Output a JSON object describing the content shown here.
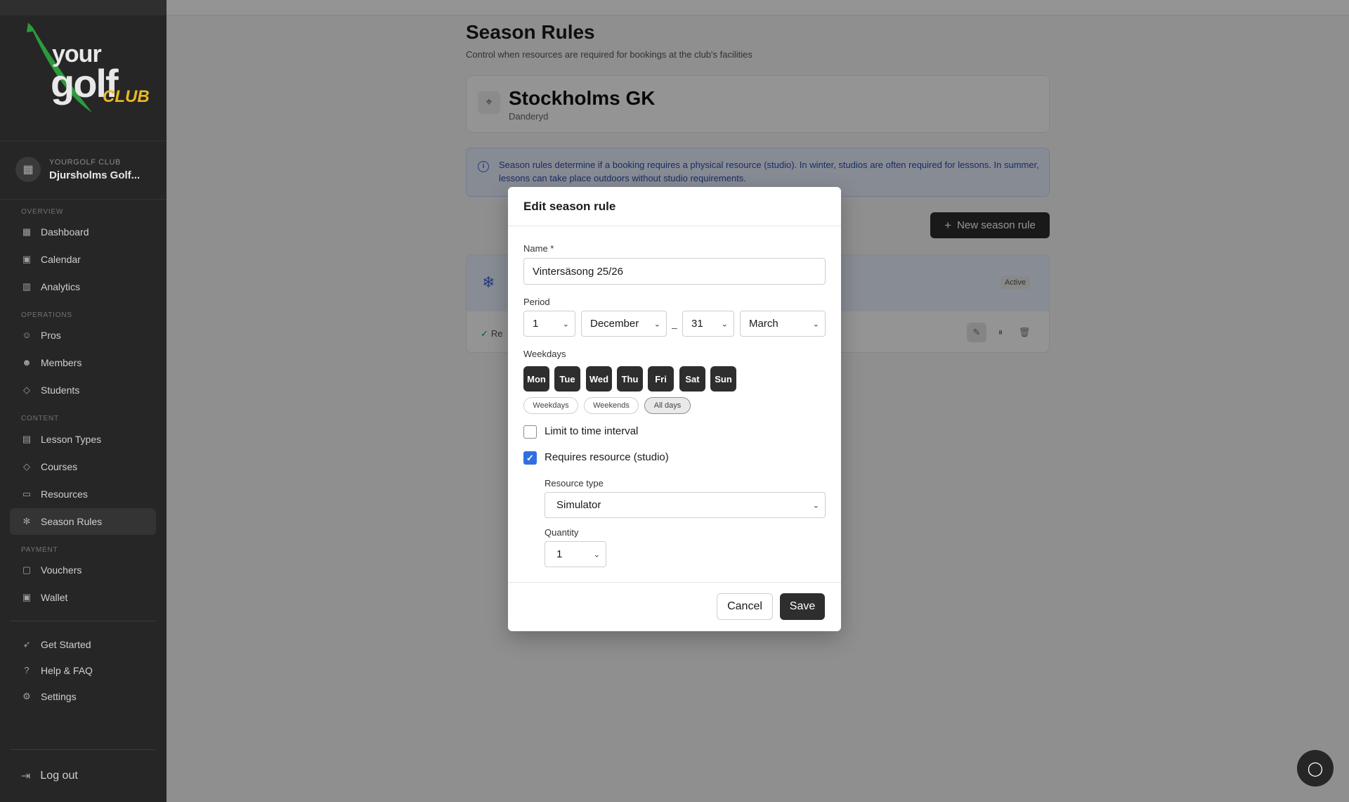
{
  "brand": {
    "logo_your": "your",
    "logo_golf": "golf",
    "logo_club": "CLUB"
  },
  "club_switcher": {
    "eyebrow": "YOURGOLF CLUB",
    "name": "Djursholms Golf..."
  },
  "sidebar": {
    "sections": {
      "overview": "OVERVIEW",
      "operations": "OPERATIONS",
      "content": "CONTENT",
      "payment": "PAYMENT"
    },
    "items": [
      {
        "label": "Dashboard",
        "icon": "grid-icon"
      },
      {
        "label": "Calendar",
        "icon": "calendar-icon"
      },
      {
        "label": "Analytics",
        "icon": "bar-chart-icon"
      },
      {
        "label": "Pros",
        "icon": "users-icon"
      },
      {
        "label": "Members",
        "icon": "user-check-icon"
      },
      {
        "label": "Students",
        "icon": "graduation-cap-icon"
      },
      {
        "label": "Lesson Types",
        "icon": "book-icon"
      },
      {
        "label": "Courses",
        "icon": "graduation-cap-icon"
      },
      {
        "label": "Resources",
        "icon": "monitor-icon"
      },
      {
        "label": "Season Rules",
        "icon": "snowflake-icon",
        "active": true
      },
      {
        "label": "Vouchers",
        "icon": "ticket-icon"
      },
      {
        "label": "Wallet",
        "icon": "wallet-icon"
      },
      {
        "label": "Get Started",
        "icon": "rocket-icon"
      },
      {
        "label": "Help & FAQ",
        "icon": "help-circle-icon"
      },
      {
        "label": "Settings",
        "icon": "gear-icon"
      }
    ],
    "logout": "Log out"
  },
  "main": {
    "title": "Season Rules",
    "subtitle": "Control when resources are required for bookings at the club's facilities",
    "club": {
      "name": "Stockholms GK",
      "location": "Danderyd"
    },
    "info": "Season rules determine if a booking requires a physical resource (studio). In winter, studios are often required for lessons. In summer, lessons can take place outdoors without studio requirements.",
    "new_button": "New season rule",
    "rule": {
      "badge": "Active",
      "row_text": "Re"
    }
  },
  "modal": {
    "title": "Edit season rule",
    "name_label": "Name *",
    "name_value": "Vintersäsong 25/26",
    "period_label": "Period",
    "period": {
      "from_day": "1",
      "from_month": "December",
      "separator": "–",
      "to_day": "31",
      "to_month": "March"
    },
    "weekdays_label": "Weekdays",
    "days": [
      "Mon",
      "Tue",
      "Wed",
      "Thu",
      "Fri",
      "Sat",
      "Sun"
    ],
    "presets": [
      "Weekdays",
      "Weekends",
      "All days"
    ],
    "limit_label": "Limit to time interval",
    "limit_checked": false,
    "requires_label": "Requires resource (studio)",
    "requires_checked": true,
    "resource_type_label": "Resource type",
    "resource_type_value": "Simulator",
    "quantity_label": "Quantity",
    "quantity_value": "1",
    "cancel": "Cancel",
    "save": "Save"
  },
  "colors": {
    "sidebar": "#262626",
    "accent_blue": "#2f6fe4",
    "brand_gold": "#e7b923",
    "brand_green": "#2e9a3e"
  }
}
